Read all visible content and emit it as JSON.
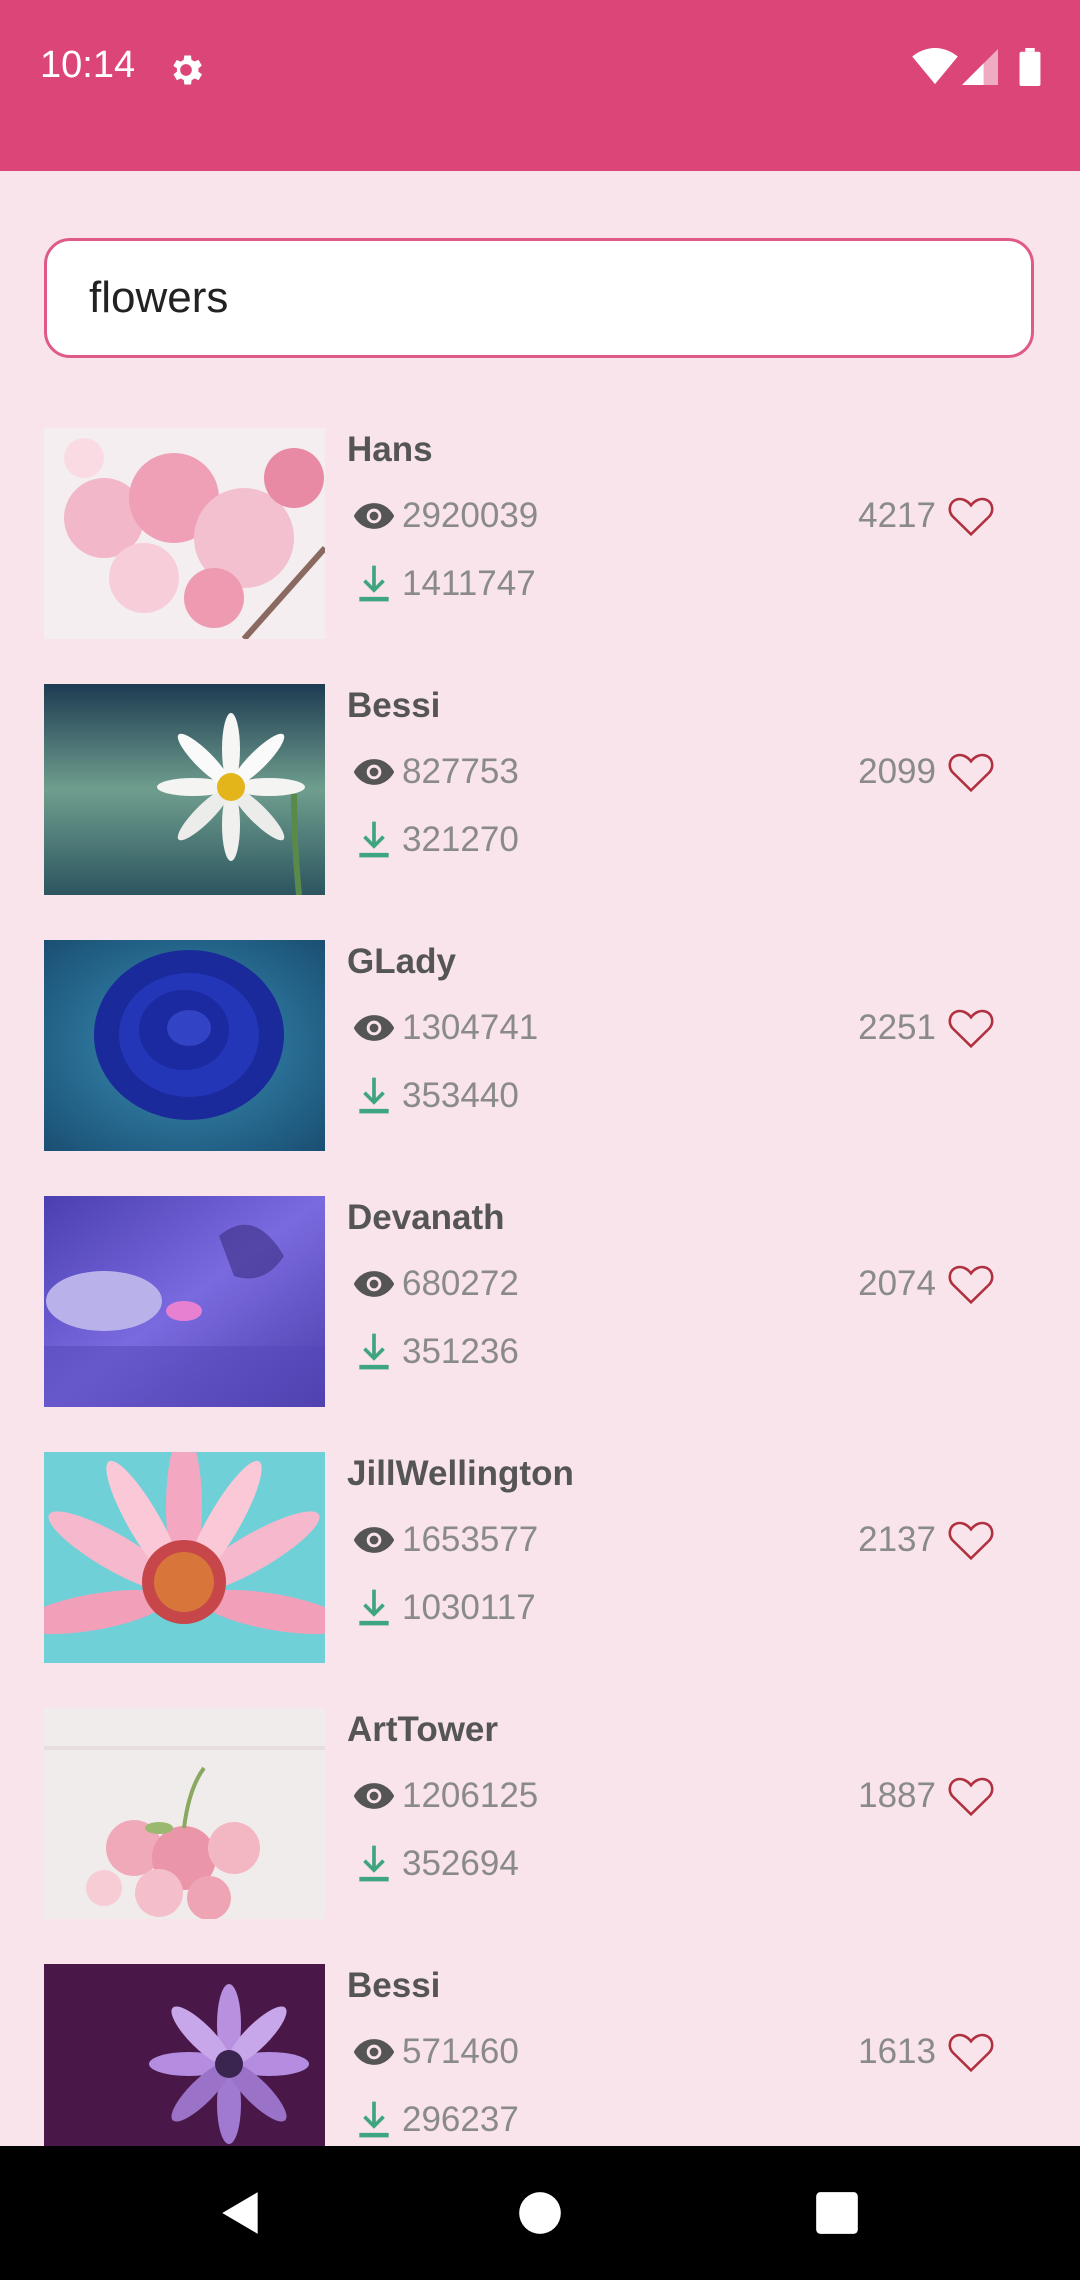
{
  "status_bar": {
    "time": "10:14",
    "icons": [
      "gear-icon",
      "wifi-icon",
      "signal-icon",
      "battery-icon"
    ],
    "color": "#db4577"
  },
  "search": {
    "value": "flowers"
  },
  "results": [
    {
      "author": "Hans",
      "views": "2920039",
      "downloads": "1411747",
      "likes": "4217",
      "image": "pink-cherry-blossom"
    },
    {
      "author": "Bessi",
      "views": "827753",
      "downloads": "321270",
      "likes": "2099",
      "image": "white-daisy"
    },
    {
      "author": "GLady",
      "views": "1304741",
      "downloads": "353440",
      "likes": "2251",
      "image": "blue-rose"
    },
    {
      "author": "Devanath",
      "views": "680272",
      "downloads": "351236",
      "likes": "2074",
      "image": "water-lily-purple"
    },
    {
      "author": "JillWellington",
      "views": "1653577",
      "downloads": "1030117",
      "likes": "2137",
      "image": "pink-gerbera"
    },
    {
      "author": "ArtTower",
      "views": "1206125",
      "downloads": "352694",
      "likes": "1887",
      "image": "pink-rose-bouquet"
    },
    {
      "author": "Bessi",
      "views": "571460",
      "downloads": "296237",
      "likes": "1613",
      "image": "purple-daisy"
    }
  ],
  "colors": {
    "accent": "#db4577",
    "download": "#3fa580",
    "heart": "#b03040",
    "background": "#f8e4ea"
  },
  "nav": {
    "icons": [
      "back-icon",
      "home-icon",
      "recents-icon"
    ]
  }
}
